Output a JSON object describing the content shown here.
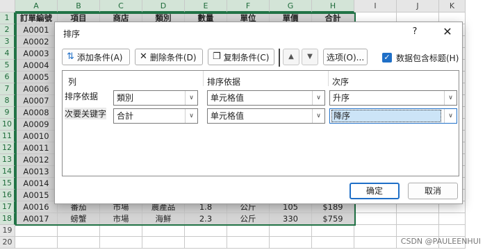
{
  "sheet": {
    "columns": [
      "A",
      "B",
      "C",
      "D",
      "E",
      "F",
      "G",
      "H",
      "I",
      "J",
      "K"
    ],
    "rows": [
      "1",
      "2",
      "3",
      "4",
      "5",
      "6",
      "7",
      "8",
      "9",
      "10",
      "11",
      "12",
      "13",
      "14",
      "15",
      "16",
      "17",
      "18",
      "19",
      "20"
    ],
    "header_row": [
      "訂單編號",
      "項目",
      "商店",
      "類別",
      "數量",
      "單位",
      "單價",
      "合計"
    ],
    "ids": [
      "A0001",
      "A0002",
      "A0003",
      "A0004",
      "A0005",
      "A0006",
      "A0007",
      "A0008",
      "A0009",
      "A0010",
      "A0011",
      "A0012",
      "A0013",
      "A0014",
      "A0015"
    ],
    "row17": [
      "A0016",
      "番茄",
      "市場",
      "農產品",
      "1.8",
      "公斤",
      "105",
      "$189"
    ],
    "row18": [
      "A0017",
      "螃蟹",
      "市場",
      "海鮮",
      "2.3",
      "公斤",
      "330",
      "$759"
    ]
  },
  "dialog": {
    "title": "排序",
    "help": "?",
    "close": "✕",
    "toolbar": {
      "add": "添加条件(A)",
      "delete": "删除条件(D)",
      "copy": "复制条件(C)",
      "options": "选项(O)...",
      "include_headers": "数据包含标题(H)",
      "include_headers_checked": true
    },
    "columns": {
      "col": "列",
      "sort_on": "排序依据",
      "order": "次序"
    },
    "rows": [
      {
        "label": "排序依据",
        "column": "類別",
        "sort_on": "单元格值",
        "order": "升序"
      },
      {
        "label": "次要关键字",
        "column": "合計",
        "sort_on": "单元格值",
        "order": "降序"
      }
    ],
    "ok": "确定",
    "cancel": "取消"
  },
  "watermark": "CSDN @PAULEENHUI"
}
